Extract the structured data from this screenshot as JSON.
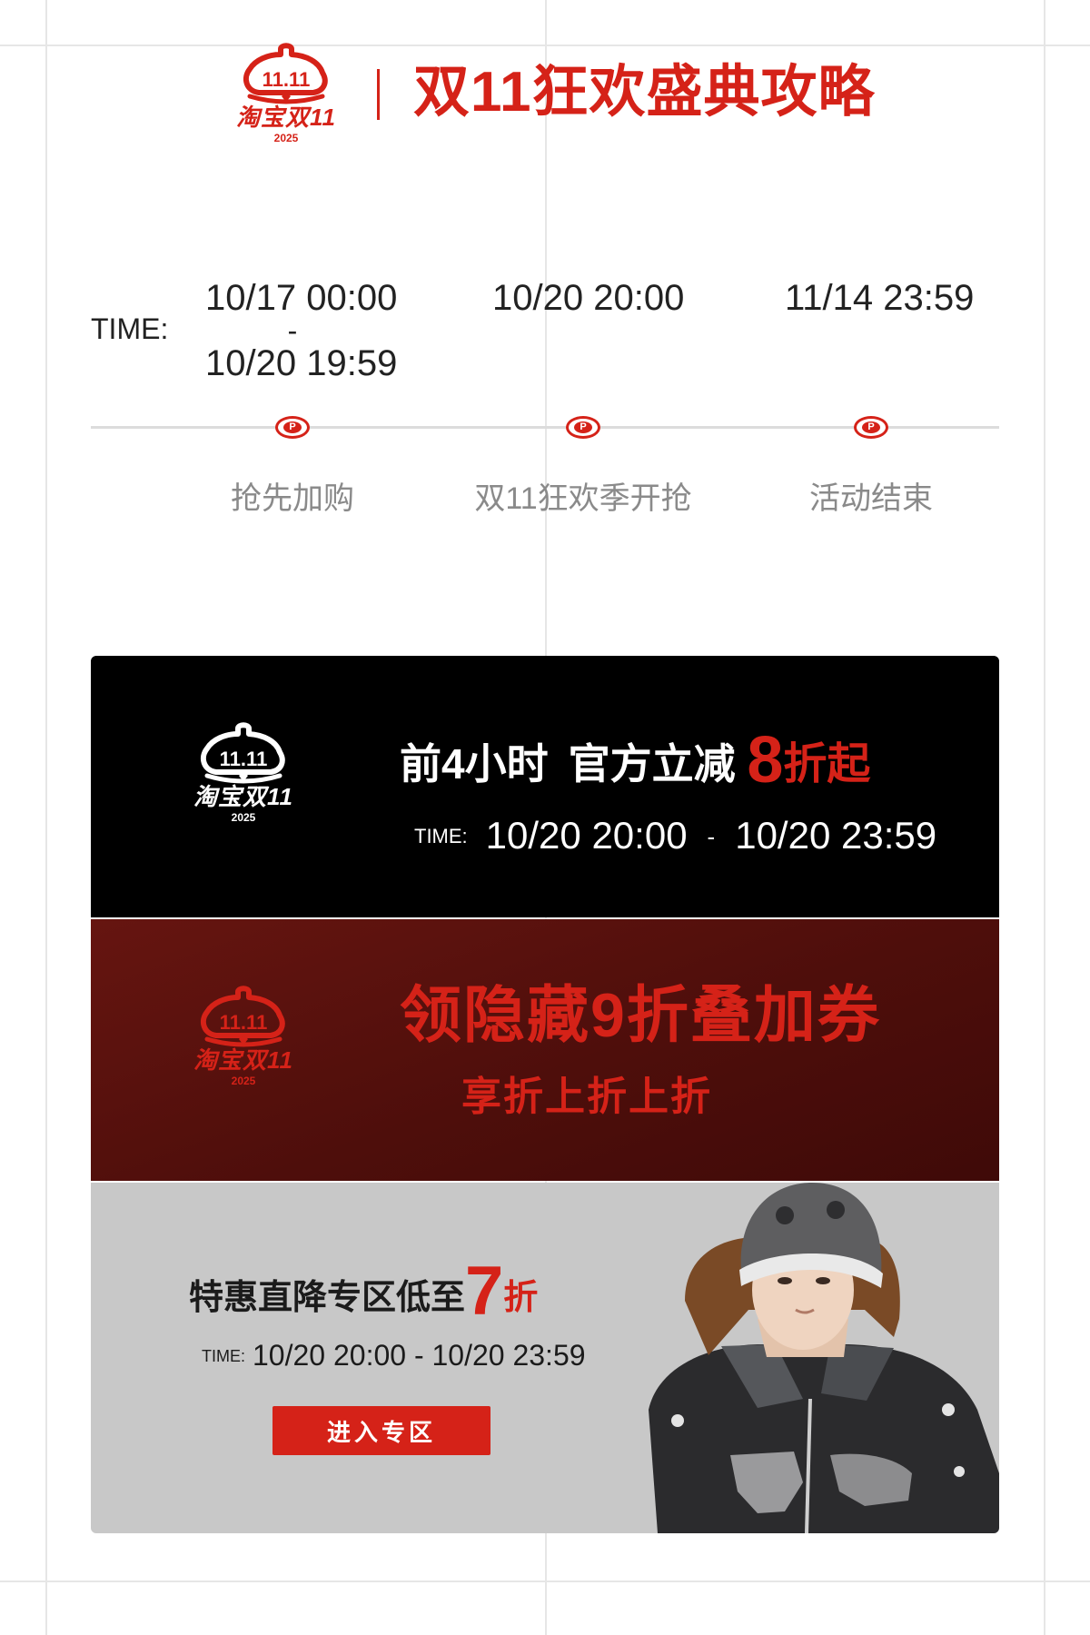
{
  "header": {
    "logo": {
      "badge": "11.11",
      "text": "淘宝双11",
      "year": "2025"
    },
    "title": "双11狂欢盛典攻略"
  },
  "timeline": {
    "label": "TIME:",
    "stages": [
      {
        "time_start": "10/17 00:00",
        "time_separator": "-",
        "time_end": "10/20 19:59",
        "label": "抢先加购",
        "marker_icon": "p-icon"
      },
      {
        "time_start": "10/20 20:00",
        "label": "双11狂欢季开抢",
        "marker_icon": "p-icon"
      },
      {
        "time_start": "11/14 23:59",
        "label": "活动结束",
        "marker_icon": "p-icon"
      }
    ]
  },
  "banners": {
    "first_hours": {
      "headline_part1": "前4小时",
      "headline_part2": "官方立减",
      "discount_number": "8",
      "discount_suffix": "折起",
      "time_label": "TIME:",
      "time_start": "10/20 20:00",
      "time_separator": "-",
      "time_end": "10/20 23:59",
      "background": "#000000"
    },
    "coupon": {
      "headline": "领隐藏9折叠加券",
      "subheadline": "享折上折上折",
      "background": "#5a110d"
    },
    "special_zone": {
      "headline_text": "特惠直降专区低至",
      "discount_number": "7",
      "discount_suffix": "折",
      "time_label": "TIME:",
      "time_range": "10/20 20:00 - 10/20 23:59",
      "button_label": "进入专区",
      "background": "#c8c8c8"
    }
  },
  "colors": {
    "accent_red": "#d52218",
    "muted_gray": "#8a8a8a",
    "timeline_line": "#dcdcdc"
  }
}
